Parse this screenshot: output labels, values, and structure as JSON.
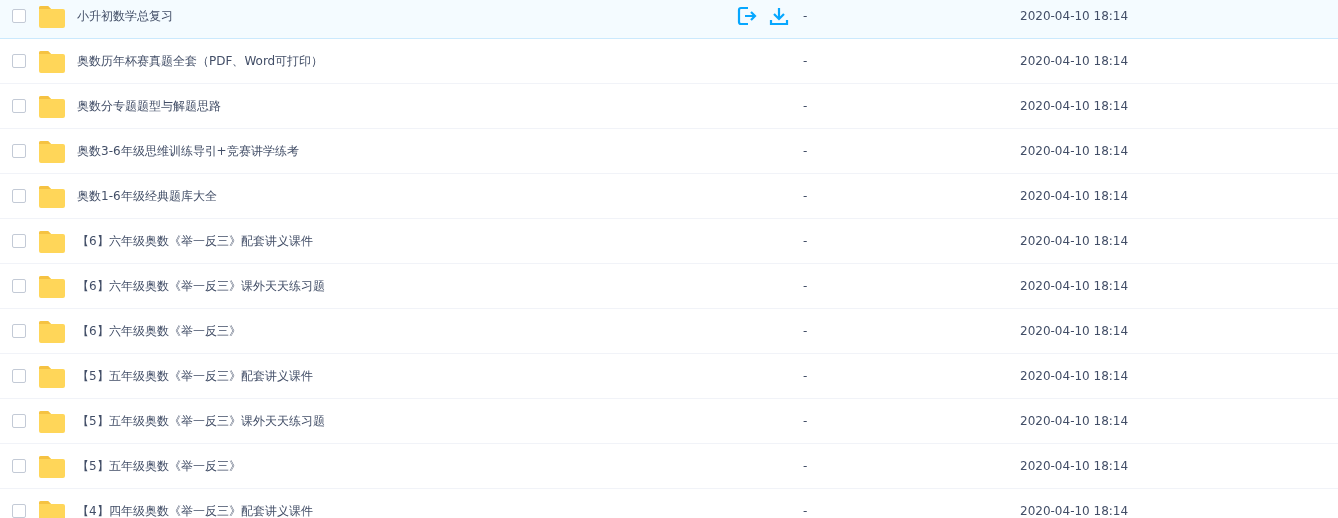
{
  "files": [
    {
      "name": "小升初数学总复习",
      "size": "-",
      "modified": "2020-04-10 18:14",
      "checked": false,
      "hovered": true
    },
    {
      "name": "奥数历年杯赛真题全套（PDF、Word可打印）",
      "size": "-",
      "modified": "2020-04-10 18:14",
      "checked": false,
      "hovered": false
    },
    {
      "name": "奥数分专题题型与解题思路",
      "size": "-",
      "modified": "2020-04-10 18:14",
      "checked": false,
      "hovered": false
    },
    {
      "name": "奥数3-6年级思维训练导引+竞赛讲学练考",
      "size": "-",
      "modified": "2020-04-10 18:14",
      "checked": false,
      "hovered": false
    },
    {
      "name": "奥数1-6年级经典题库大全",
      "size": "-",
      "modified": "2020-04-10 18:14",
      "checked": false,
      "hovered": false
    },
    {
      "name": "【6】六年级奥数《举一反三》配套讲义课件",
      "size": "-",
      "modified": "2020-04-10 18:14",
      "checked": false,
      "hovered": false
    },
    {
      "name": "【6】六年级奥数《举一反三》课外天天练习题",
      "size": "-",
      "modified": "2020-04-10 18:14",
      "checked": false,
      "hovered": false
    },
    {
      "name": "【6】六年级奥数《举一反三》",
      "size": "-",
      "modified": "2020-04-10 18:14",
      "checked": false,
      "hovered": false
    },
    {
      "name": "【5】五年级奥数《举一反三》配套讲义课件",
      "size": "-",
      "modified": "2020-04-10 18:14",
      "checked": false,
      "hovered": false
    },
    {
      "name": "【5】五年级奥数《举一反三》课外天天练习题",
      "size": "-",
      "modified": "2020-04-10 18:14",
      "checked": false,
      "hovered": false
    },
    {
      "name": "【5】五年级奥数《举一反三》",
      "size": "-",
      "modified": "2020-04-10 18:14",
      "checked": false,
      "hovered": false
    },
    {
      "name": "【4】四年级奥数《举一反三》配套讲义课件",
      "size": "-",
      "modified": "2020-04-10 18:14",
      "checked": false,
      "hovered": false
    }
  ]
}
